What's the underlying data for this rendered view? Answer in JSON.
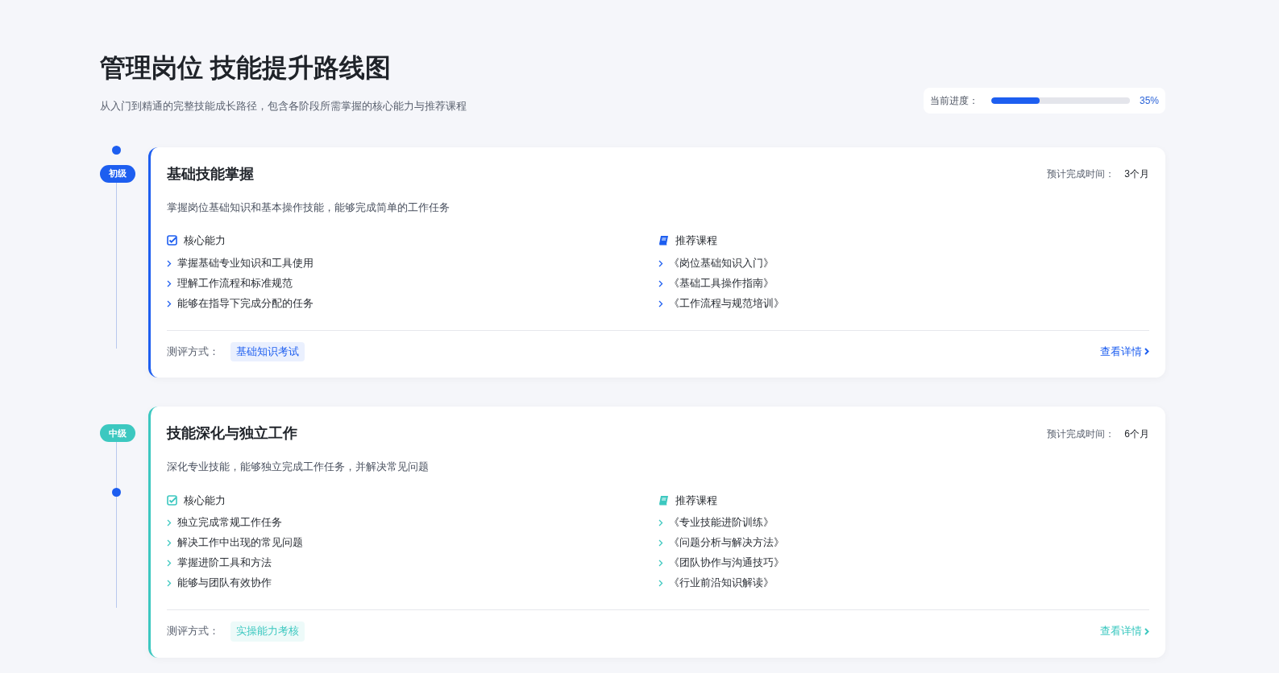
{
  "header": {
    "title": "管理岗位 技能提升路线图",
    "subtitle": "从入门到精通的完整技能成长路径，包含各阶段所需掌握的核心能力与推荐课程"
  },
  "progress": {
    "label": "当前进度：",
    "level": 0.35,
    "reading": "35%"
  },
  "stages": [
    {
      "badge": "初级",
      "color": "#1d5ef0",
      "dot_above_badge": true,
      "title": "基础技能掌握",
      "duration_label": "预计完成时间：",
      "duration": "3个月",
      "description": "掌握岗位基础知识和基本操作技能，能够完成简单的工作任务",
      "skills_heading": "核心能力",
      "skills": [
        "掌握基础专业知识和工具使用",
        "理解工作流程和标准规范",
        "能够在指导下完成分配的任务"
      ],
      "courses_heading": "推荐课程",
      "courses": [
        "《岗位基础知识入门》",
        "《基础工具操作指南》",
        "《工作流程与规范培训》"
      ],
      "assessment_label": "测评方式：",
      "assessment": "基础知识考试",
      "details": "查看详情"
    },
    {
      "badge": "中级",
      "color": "#3cc8c0",
      "dot_above_badge": false,
      "title": "技能深化与独立工作",
      "duration_label": "预计完成时间：",
      "duration": "6个月",
      "description": "深化专业技能，能够独立完成工作任务，并解决常见问题",
      "skills_heading": "核心能力",
      "skills": [
        "独立完成常规工作任务",
        "解决工作中出现的常见问题",
        "掌握进阶工具和方法",
        "能够与团队有效协作"
      ],
      "courses_heading": "推荐课程",
      "courses": [
        "《专业技能进阶训练》",
        "《问题分析与解决方法》",
        "《团队协作与沟通技巧》",
        "《行业前沿知识解读》"
      ],
      "assessment_label": "测评方式：",
      "assessment": "实操能力考核",
      "details": "查看详情"
    }
  ]
}
